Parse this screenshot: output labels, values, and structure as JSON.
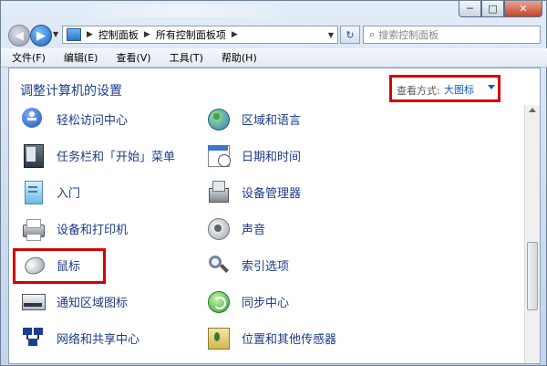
{
  "window": {
    "controls": [
      "─",
      "□",
      "✕"
    ]
  },
  "nav": {
    "back_icon": "◀",
    "forward_icon": "▶",
    "breadcrumb": [
      "控制面板",
      "所有控制面板项"
    ],
    "refresh_icon": "↻",
    "search_placeholder": "搜索控制面板"
  },
  "menu": [
    "文件(F)",
    "编辑(E)",
    "查看(V)",
    "工具(T)",
    "帮助(H)"
  ],
  "content": {
    "title": "调整计算机的设置",
    "view_label": "查看方式:",
    "view_value": "大图标"
  },
  "items_left": [
    {
      "label": "轻松访问中心",
      "icon": "ease-of-access-icon"
    },
    {
      "label": "任务栏和「开始」菜单",
      "icon": "taskbar-icon"
    },
    {
      "label": "入门",
      "icon": "getting-started-icon"
    },
    {
      "label": "设备和打印机",
      "icon": "printer-icon"
    },
    {
      "label": "鼠标",
      "icon": "mouse-icon"
    },
    {
      "label": "通知区域图标",
      "icon": "notification-area-icon"
    },
    {
      "label": "网络和共享中心",
      "icon": "network-icon"
    }
  ],
  "items_right": [
    {
      "label": "区域和语言",
      "icon": "globe-icon"
    },
    {
      "label": "日期和时间",
      "icon": "calendar-icon"
    },
    {
      "label": "设备管理器",
      "icon": "device-manager-icon"
    },
    {
      "label": "声音",
      "icon": "speaker-icon"
    },
    {
      "label": "索引选项",
      "icon": "index-options-icon"
    },
    {
      "label": "同步中心",
      "icon": "sync-icon"
    },
    {
      "label": "位置和其他传感器",
      "icon": "location-sensor-icon"
    }
  ],
  "colors": {
    "link_text": "#1d3b8a",
    "title_text": "#1e3f8b",
    "highlight": "#d60000"
  }
}
